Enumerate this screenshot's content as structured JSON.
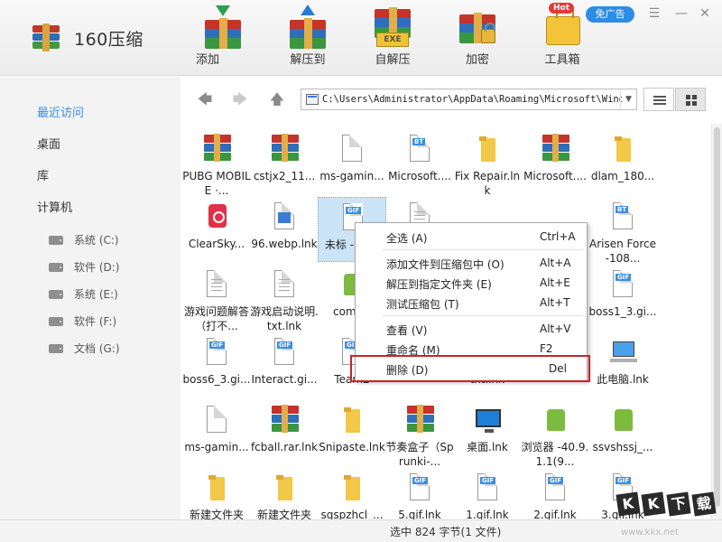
{
  "app": {
    "name": "160压缩"
  },
  "toolbar": {
    "items": [
      {
        "label": "添加",
        "icon": "add-archive-icon"
      },
      {
        "label": "解压到",
        "icon": "extract-to-icon"
      },
      {
        "label": "自解压",
        "icon": "self-extract-icon",
        "tag": "EXE"
      },
      {
        "label": "加密",
        "icon": "encrypt-icon"
      },
      {
        "label": "工具箱",
        "icon": "toolbox-icon",
        "badge": "Hot"
      }
    ],
    "adfree_label": "免广告"
  },
  "window_controls": {
    "menu": "☰",
    "minimize": "—",
    "close": "✕"
  },
  "sidebar": {
    "nav": [
      {
        "label": "最近访问",
        "active": true
      },
      {
        "label": "桌面"
      },
      {
        "label": "库"
      },
      {
        "label": "计算机"
      }
    ],
    "drives": [
      {
        "label": "系统 (C:)"
      },
      {
        "label": "软件 (D:)"
      },
      {
        "label": "系统 (E:)"
      },
      {
        "label": "软件 (F:)"
      },
      {
        "label": "文档 (G:)"
      }
    ]
  },
  "navbar": {
    "back": "🡄",
    "forward": "🡆",
    "up": "🡅",
    "address": "C:\\Users\\Administrator\\AppData\\Roaming\\Microsoft\\Window",
    "dropdown": "▼"
  },
  "files": [
    {
      "name": "PUBG MOBILE ·...",
      "type": "rar"
    },
    {
      "name": "cstjx2_11...",
      "type": "rar"
    },
    {
      "name": "ms-gamin...",
      "type": "doc"
    },
    {
      "name": "Microsoft....",
      "type": "bt"
    },
    {
      "name": "Fix Repair.lnk",
      "type": "folder"
    },
    {
      "name": "Microsoft....",
      "type": "rar"
    },
    {
      "name": "dlam_180...",
      "type": "folder"
    },
    {
      "name": "ClearSky...",
      "type": "red"
    },
    {
      "name": "96.webp.lnk",
      "type": "pic"
    },
    {
      "name": "未标 -10.gi",
      "type": "gif",
      "selected": true
    },
    {
      "name": "Arisen Force-108...",
      "type": "bt"
    },
    {
      "name": "游戏问题解答（打不...",
      "type": "txt"
    },
    {
      "name": "游戏启动说明.txt.lnk",
      "type": "txt"
    },
    {
      "name": "com.pr",
      "type": "android"
    },
    {
      "name": "boss1_3.gi...",
      "type": "gif"
    },
    {
      "name": "boss6_3.gi...",
      "type": "gif"
    },
    {
      "name": "Interact.gi...",
      "type": "gif"
    },
    {
      "name": "Team2",
      "type": "gif"
    },
    {
      "name": "txt.lnk",
      "type": "hidden"
    },
    {
      "name": "此电脑.lnk",
      "type": "pc"
    },
    {
      "name": "ms-gamin...",
      "type": "doc"
    },
    {
      "name": "fcball.rar.lnk",
      "type": "rar"
    },
    {
      "name": "Snipaste.lnk",
      "type": "folder"
    },
    {
      "name": "节奏盒子（Sprunki-...",
      "type": "rar"
    },
    {
      "name": "桌面.lnk",
      "type": "monitor"
    },
    {
      "name": "浏览器 -40.9.1.1(9...",
      "type": "android"
    },
    {
      "name": "ssvshssj_...",
      "type": "android"
    },
    {
      "name": "新建文件夹",
      "type": "folder"
    },
    {
      "name": "新建文件夹",
      "type": "folder"
    },
    {
      "name": "sqspzhcl_...",
      "type": "folder"
    },
    {
      "name": "5.gif.lnk",
      "type": "gif"
    },
    {
      "name": "1.gif.lnk",
      "type": "gif"
    },
    {
      "name": "2.gif.lnk",
      "type": "gif"
    },
    {
      "name": "3.gif.lnk",
      "type": "gif"
    }
  ],
  "context_menu": {
    "items": [
      {
        "label": "全选 (A)",
        "key": "Ctrl+A"
      },
      {
        "label": "添加文件到压缩包中 (O)",
        "key": "Alt+A"
      },
      {
        "label": "解压到指定文件夹 (E)",
        "key": "Alt+E"
      },
      {
        "label": "测试压缩包 (T)",
        "key": "Alt+T"
      },
      {
        "label": "查看 (V)",
        "key": "Alt+V"
      },
      {
        "label": "重命名 (M)",
        "key": "F2"
      },
      {
        "label": "删除 (D)",
        "key": "Del",
        "highlighted": true
      }
    ]
  },
  "status": {
    "text": "选中  824 字节(1 文件)"
  },
  "watermark": {
    "letters": [
      "K",
      "K",
      "下",
      "载"
    ],
    "url": "www.kkx.net"
  },
  "colors": {
    "accent": "#3a8ee6",
    "highlight_box": "#c8232c",
    "selection": "#cce4f7"
  }
}
